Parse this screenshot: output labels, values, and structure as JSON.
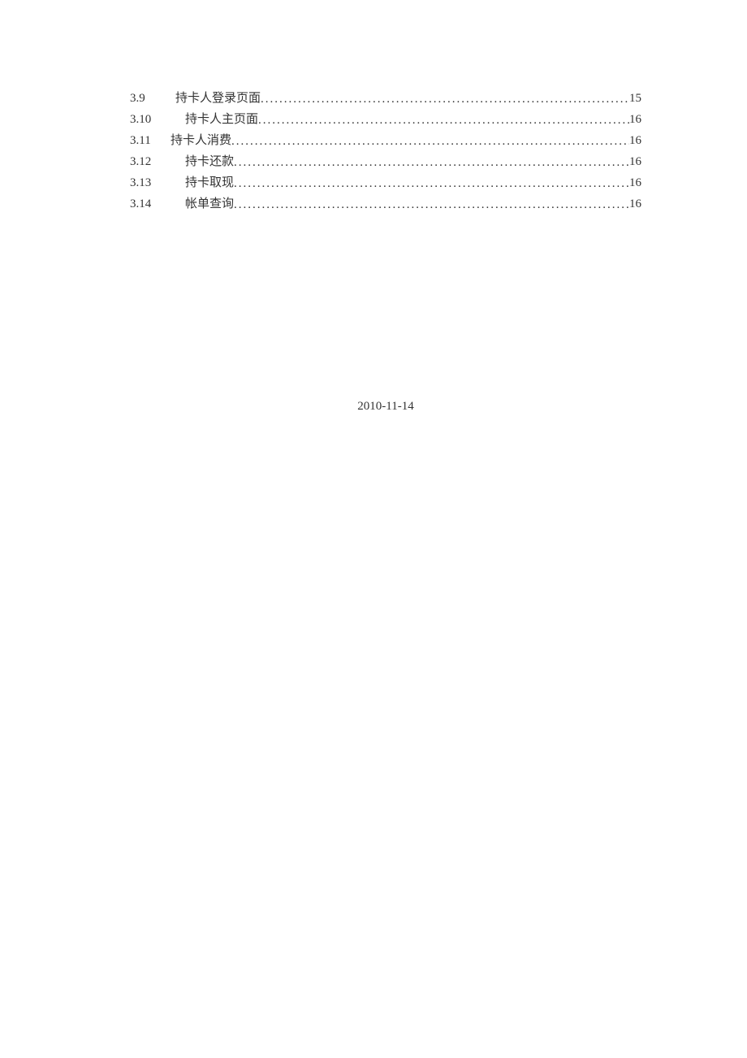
{
  "toc": {
    "entries": [
      {
        "number": "3.9",
        "title": "持卡人登录页面",
        "page": "15",
        "indent": "a"
      },
      {
        "number": "3.10",
        "title": "持卡人主页面",
        "page": "16",
        "indent": "b"
      },
      {
        "number": "3.11",
        "title": "持卡人消费",
        "page": "16",
        "indent": "c"
      },
      {
        "number": "3.12",
        "title": "持卡还款",
        "page": "16",
        "indent": "b"
      },
      {
        "number": "3.13",
        "title": "持卡取现",
        "page": "16",
        "indent": "b"
      },
      {
        "number": "3.14",
        "title": "帐单查询",
        "page": "16",
        "indent": "b"
      }
    ]
  },
  "date": "2010-11-14"
}
